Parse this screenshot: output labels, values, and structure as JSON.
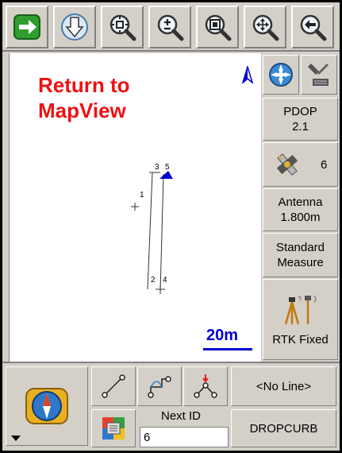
{
  "toolbar": {
    "buttons": [
      {
        "name": "return-arrow-button",
        "icon": "green-right-arrow-icon"
      },
      {
        "name": "download-button",
        "icon": "down-arrow-tray-icon"
      },
      {
        "name": "zoom-extents-button",
        "icon": "magnifier-extents-icon"
      },
      {
        "name": "zoom-in-out-button",
        "icon": "magnifier-plus-minus-icon"
      },
      {
        "name": "zoom-window-button",
        "icon": "magnifier-window-icon"
      },
      {
        "name": "pan-button",
        "icon": "magnifier-pan-icon"
      },
      {
        "name": "back-button",
        "icon": "magnifier-back-arrow-icon"
      }
    ]
  },
  "map": {
    "title": "Return to\nMapView",
    "scale_label": "20m",
    "points": [
      "1",
      "2",
      "3",
      "4",
      "5"
    ]
  },
  "right_panel": {
    "pdop_label": "PDOP",
    "pdop_value": "2.1",
    "satellites": "6",
    "antenna_label": "Antenna",
    "antenna_height": "1.800m",
    "measure_line1": "Standard",
    "measure_line2": "Measure",
    "rtk_status": "RTK Fixed"
  },
  "bottom": {
    "line_select": "<No Line>",
    "next_id_label": "Next ID",
    "next_id_value": "6",
    "code": "DROPCURB"
  },
  "colors": {
    "accent_red": "#ee1111",
    "map_blue": "#0000cc",
    "panel_gray": "#d4d0c8"
  }
}
